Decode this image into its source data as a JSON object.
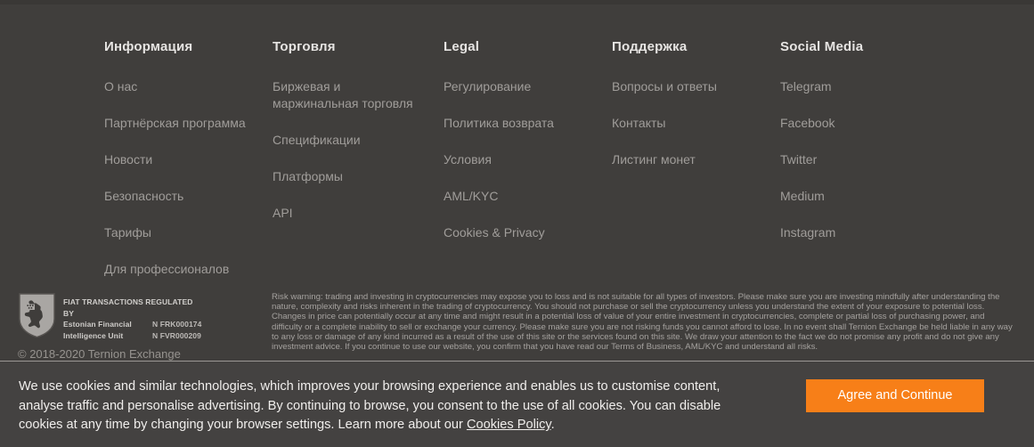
{
  "footer": {
    "columns": [
      {
        "title": "Информация",
        "links": [
          "О нас",
          "Партнёрская программа",
          "Новости",
          "Безопасность",
          "Тарифы",
          "Для профессионалов"
        ]
      },
      {
        "title": "Торговля",
        "links": [
          "Биржевая и маржинальная торговля",
          "Спецификации",
          "Платформы",
          "API"
        ]
      },
      {
        "title": "Legal",
        "links": [
          "Регулирование",
          "Политика возврата",
          "Условия",
          "AML/KYC",
          "Cookies & Privacy"
        ]
      },
      {
        "title": "Поддержка",
        "links": [
          "Вопросы и ответы",
          "Контакты",
          "Листинг монет"
        ]
      },
      {
        "title": "Social Media",
        "links": [
          "Telegram",
          "Facebook",
          "Twitter",
          "Medium",
          "Instagram"
        ]
      }
    ],
    "badge": {
      "icon": "estonian-coat-of-arms-shield",
      "line1": "FIAT TRANSACTIONS REGULATED",
      "line2": "BY",
      "authority_line1": "Estonian Financial",
      "authority_line2": "Intelligence Unit",
      "code1": "N FRK000174",
      "code2": "N FVR000209"
    },
    "copyright": "© 2018-2020 Ternion Exchange",
    "risk_warning": "Risk warning: trading and investing in cryptocurrencies may expose you to loss and is not suitable for all types of investors. Please make sure you are investing mindfully after understanding the nature, complexity and risks inherent in the trading of cryptocurrency. You should not purchase or sell the cryptocurrency unless you understand the extent of your exposure to potential loss. Changes in price can potentially occur at any time and might result in a potential loss of value of your entire investment in cryptocurrencies, complete or partial loss of purchasing power, and difficulty or a complete inability to sell or exchange your currency. Please make sure you are not risking funds you cannot afford to lose. In no event shall Ternion Exchange be held liable in any way to any loss or damage of any kind incurred as a result of the use of this site or the services found on this site. We draw your attention to the fact we do not promise any profit and do not give any investment advice. If you continue to use our website, you confirm that you have read our Terms of Business, AML/KYC and understand all risks."
  },
  "cookie_banner": {
    "text_before_link": "We use cookies and similar technologies, which improves your browsing experience and enables us to customise content, analyse traffic and personalise advertising. By continuing to browse, you consent to the use of all cookies. You can disable cookies at any time by changing your browser settings. Learn more about our ",
    "link_text": "Cookies Policy",
    "text_after_link": ".",
    "button_label": "Agree and Continue",
    "button_color": "#f77f18"
  },
  "theme": {
    "background": "#403e3c",
    "banner_background": "#444241",
    "heading_color": "#e6e4e2",
    "link_color": "#a09d9a",
    "accent": "#f77f18"
  }
}
